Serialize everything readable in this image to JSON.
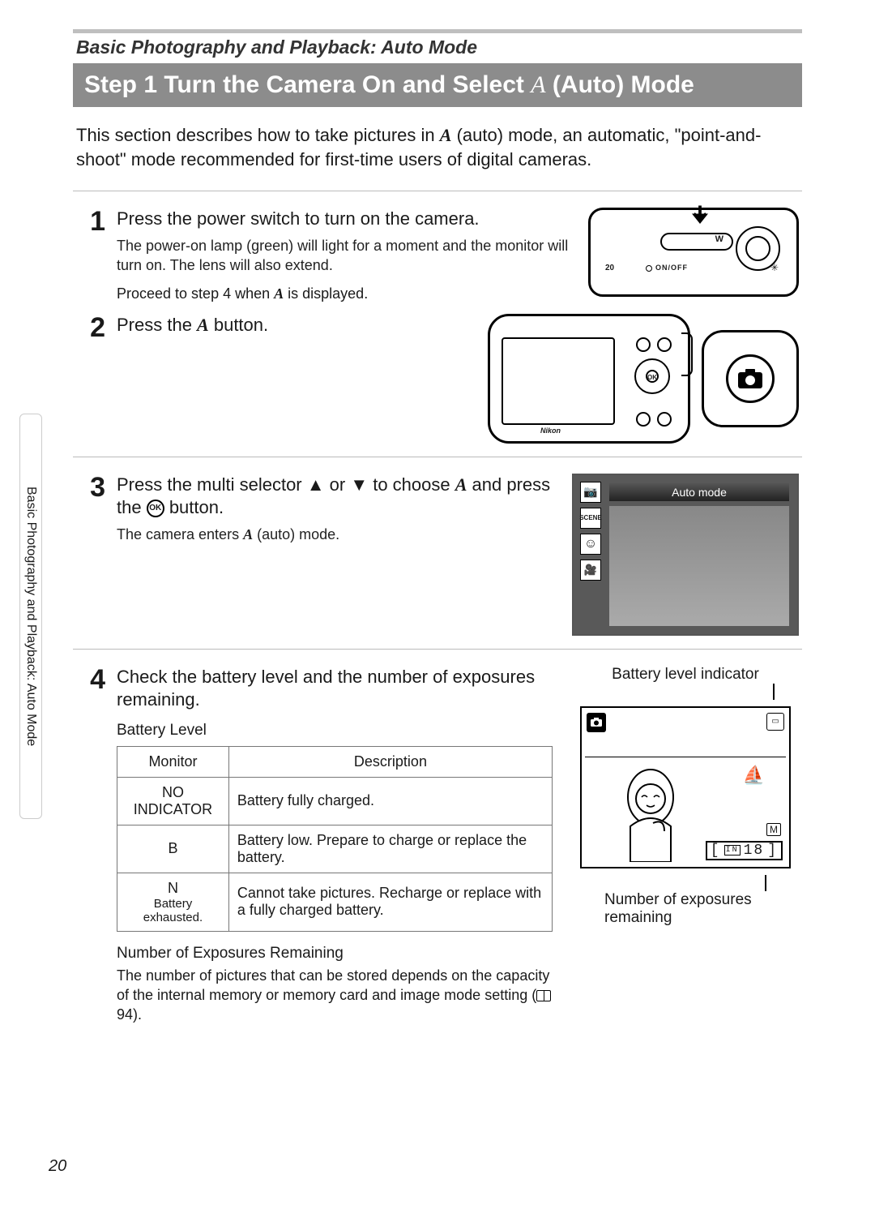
{
  "breadcrumb": "Basic Photography and Playback: Auto Mode",
  "title_prefix": "Step 1 Turn the Camera On and Select ",
  "title_mode_glyph": "A",
  "title_suffix": " (Auto) Mode",
  "intro_part1": "This section describes how to take pictures in ",
  "intro_glyph": "A",
  "intro_part2": " (auto) mode, an automatic, \"point-and-shoot\" mode recommended for first-time users of digital cameras.",
  "side_tab": "Basic Photography and Playback: Auto Mode",
  "page_number": "20",
  "steps": {
    "s1": {
      "num": "1",
      "head": "Press the power switch to turn on the camera.",
      "sub": "The power-on lamp (green) will light for a moment and the monitor will turn on. The lens will also extend.",
      "sub2a": "Proceed to step 4 when ",
      "sub2_glyph": "A",
      "sub2b": " is displayed.",
      "onoff": "ON/OFF",
      "twenty": "20",
      "w": "W"
    },
    "s2": {
      "num": "2",
      "head_a": "Press the ",
      "head_glyph": "A",
      "head_b": " button.",
      "brand": "Nikon"
    },
    "s3": {
      "num": "3",
      "head_a": "Press the multi selector ",
      "tri_up": "▲",
      "head_b": " or ",
      "tri_down": "▼",
      "head_c": " to choose ",
      "head_glyph": "A",
      "head_d": " and press the ",
      "ok": "OK",
      "head_e": " button.",
      "sub_a": "The camera enters ",
      "sub_glyph": "A",
      "sub_b": " (auto) mode.",
      "menu_label": "Auto mode",
      "scene": "SCENE"
    },
    "s4": {
      "num": "4",
      "head": "Check the battery level and the number of exposures remaining.",
      "battery_level_label": "Battery Level",
      "table": {
        "h1": "Monitor",
        "h2": "Description",
        "r1c1": "NO INDICATOR",
        "r1c2": "Battery fully charged.",
        "r2c1": "B",
        "r2c2": "Battery low. Prepare to charge or replace the battery.",
        "r3c1": "N",
        "r3c1b": "Battery exhausted.",
        "r3c2": "Cannot take pictures. Recharge or replace with a fully charged battery."
      },
      "num_exp_head": "Number of Exposures Remaining",
      "num_exp_text_a": "The number of pictures that can be stored depends on the capacity of the internal memory or memory card and image mode setting (",
      "num_exp_ref": " 94).",
      "right": {
        "batt_label": "Battery level indicator",
        "exp_label": "Number of exposures remaining",
        "m": "M",
        "in": "IN",
        "count": "18"
      }
    }
  }
}
